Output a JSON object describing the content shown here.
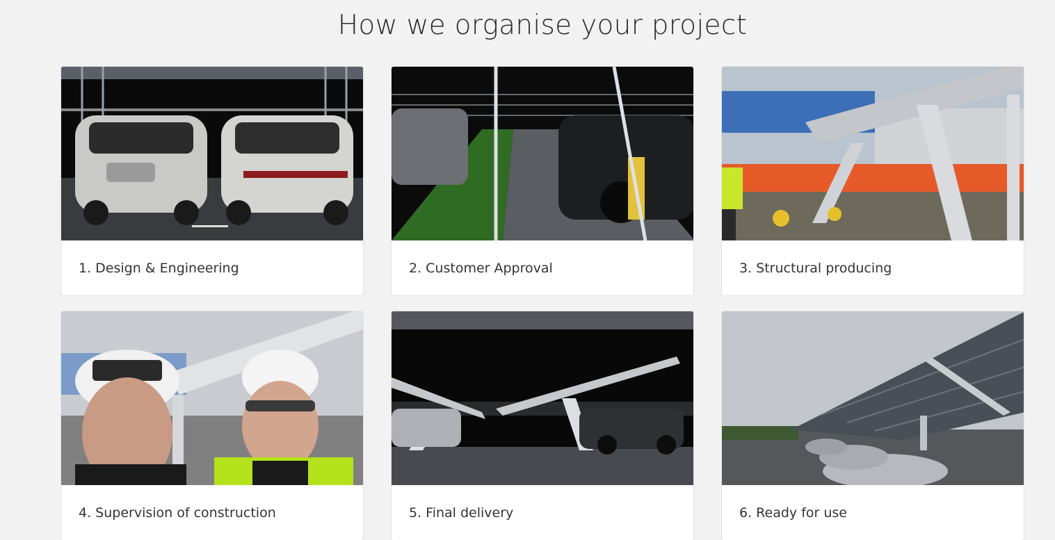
{
  "section": {
    "title": "How we organise your project"
  },
  "steps": [
    {
      "label": "1. Design & Engineering",
      "image": "render-suvs-under-carport"
    },
    {
      "label": "2. Customer Approval",
      "image": "render-wireframe-parking-row"
    },
    {
      "label": "3. Structural producing",
      "image": "photo-steel-frame-construction-site"
    },
    {
      "label": "4. Supervision of construction",
      "image": "photo-workers-selfie-helmets"
    },
    {
      "label": "5. Final delivery",
      "image": "render-solar-carport-side-view"
    },
    {
      "label": "6. Ready for use",
      "image": "photo-solar-carport-finished"
    }
  ]
}
